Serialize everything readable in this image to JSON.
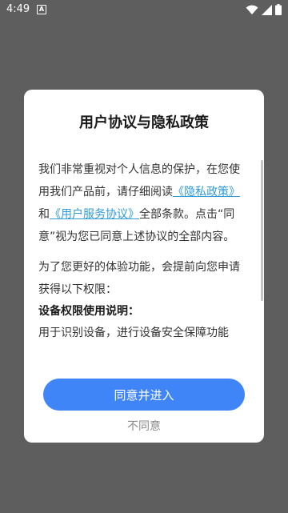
{
  "status_bar": {
    "time": "4:49",
    "notification_badge": "A",
    "icons": [
      "wifi-icon",
      "signal-icon",
      "battery-icon"
    ]
  },
  "dialog": {
    "title": "用户协议与隐私政策",
    "para1_before": "我们非常重视对个人信息的保护，在您使用我们产品前，请仔细阅读",
    "privacy_link": "《隐私政策》",
    "and_text": "和",
    "service_link": "《用户服务协议》",
    "para1_after": "全部条款。点击“同意”视为您已同意上述协议的全部内容。",
    "para2": "为了您更好的体验功能，会提前向您申请获得以下权限：",
    "subheading": "设备权限使用说明：",
    "para3": "用于识别设备，进行设备安全保障功能",
    "agree_label": "同意并进入",
    "disagree_label": "不同意"
  },
  "colors": {
    "overlay": "#5e5e5e",
    "link": "#2f9bd7",
    "primary_button": "#3f85f7"
  }
}
